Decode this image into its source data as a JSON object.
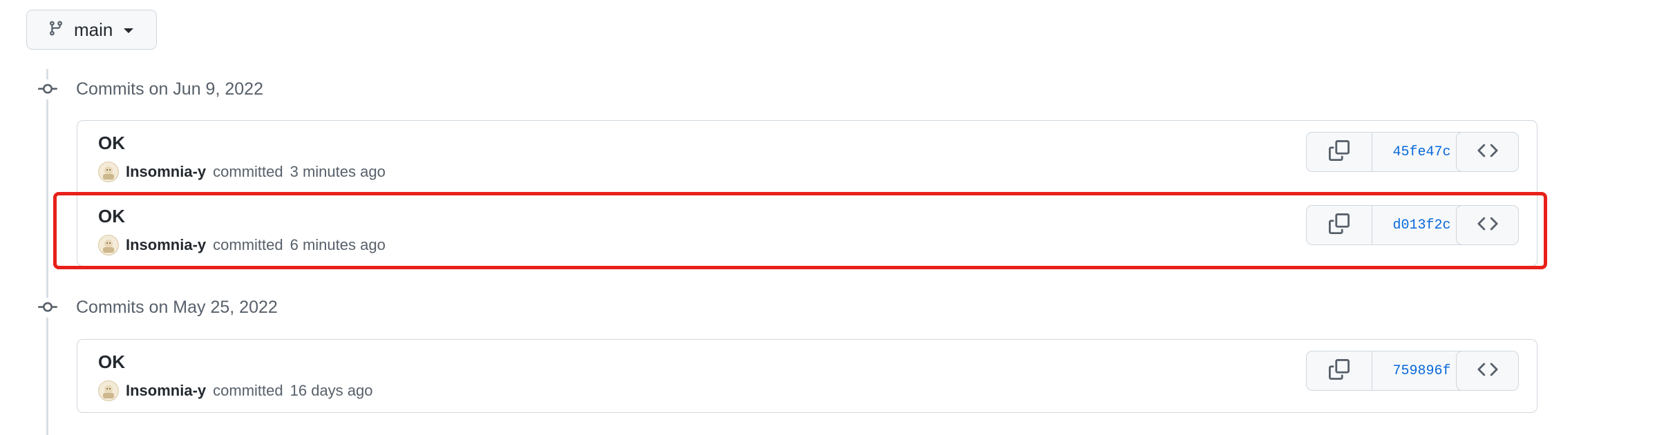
{
  "branch": {
    "label": "main",
    "icon": "git-branch-icon"
  },
  "groups": [
    {
      "title": "Commits on Jun 9, 2022",
      "commits": [
        {
          "message": "OK",
          "author": "Insomnia-y",
          "action": "committed",
          "time": "3 minutes ago",
          "sha": "45fe47c"
        },
        {
          "message": "OK",
          "author": "Insomnia-y",
          "action": "committed",
          "time": "6 minutes ago",
          "sha": "d013f2c",
          "highlighted": true
        }
      ]
    },
    {
      "title": "Commits on May 25, 2022",
      "commits": [
        {
          "message": "OK",
          "author": "Insomnia-y",
          "action": "committed",
          "time": "16 days ago",
          "sha": "759896f"
        }
      ]
    }
  ],
  "colors": {
    "highlight": "#e8201a",
    "sha_link": "#0969da",
    "border": "#d0d7de"
  }
}
